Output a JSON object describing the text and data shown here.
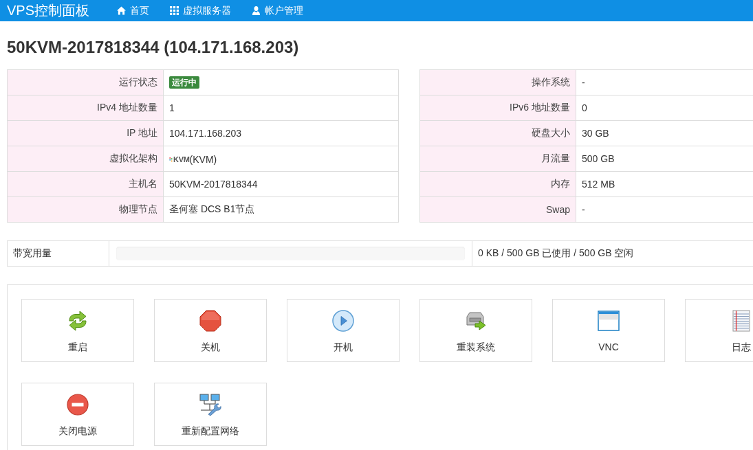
{
  "navbar": {
    "brand": "VPS控制面板",
    "items": [
      {
        "label": "首页",
        "kind": "home"
      },
      {
        "label": "虚拟服务器",
        "kind": "grid"
      },
      {
        "label": "帐户管理",
        "kind": "user"
      }
    ]
  },
  "title": "50KVM-2017818344 (104.171.168.203)",
  "info_left": [
    {
      "label": "运行状态",
      "kind": "badge",
      "value": "运行中"
    },
    {
      "label": "IPv4 地址数量",
      "kind": "text",
      "value": "1"
    },
    {
      "label": "IP 地址",
      "kind": "text",
      "value": "104.171.168.203"
    },
    {
      "label": "虚拟化架构",
      "kind": "logo",
      "logo_text": "KVM",
      "value": "(KVM)"
    },
    {
      "label": "主机名",
      "kind": "text",
      "value": "50KVM-2017818344"
    },
    {
      "label": "物理节点",
      "kind": "text",
      "value": "圣何塞 DCS B1节点"
    }
  ],
  "info_right": [
    {
      "label": "操作系统",
      "kind": "text",
      "value": "-"
    },
    {
      "label": "IPv6 地址数量",
      "kind": "text",
      "value": "0"
    },
    {
      "label": "硬盘大小",
      "kind": "text",
      "value": "30 GB"
    },
    {
      "label": "月流量",
      "kind": "text",
      "value": "500 GB"
    },
    {
      "label": "内存",
      "kind": "text",
      "value": "512 MB"
    },
    {
      "label": "Swap",
      "kind": "text",
      "value": "-"
    }
  ],
  "bandwidth": {
    "label": "带宽用量",
    "level": 0,
    "reading": "0 KB / 500 GB 已使用 / 500 GB 空闲"
  },
  "actions": [
    {
      "label": "重启",
      "kind": "restart"
    },
    {
      "label": "关机",
      "kind": "shutdown"
    },
    {
      "label": "开机",
      "kind": "start"
    },
    {
      "label": "重装系统",
      "kind": "reinstall"
    },
    {
      "label": "VNC",
      "kind": "vnc"
    },
    {
      "label": "日志",
      "kind": "log"
    },
    {
      "label": "关闭电源",
      "kind": "poweroff"
    },
    {
      "label": "重新配置网络",
      "kind": "network"
    }
  ]
}
